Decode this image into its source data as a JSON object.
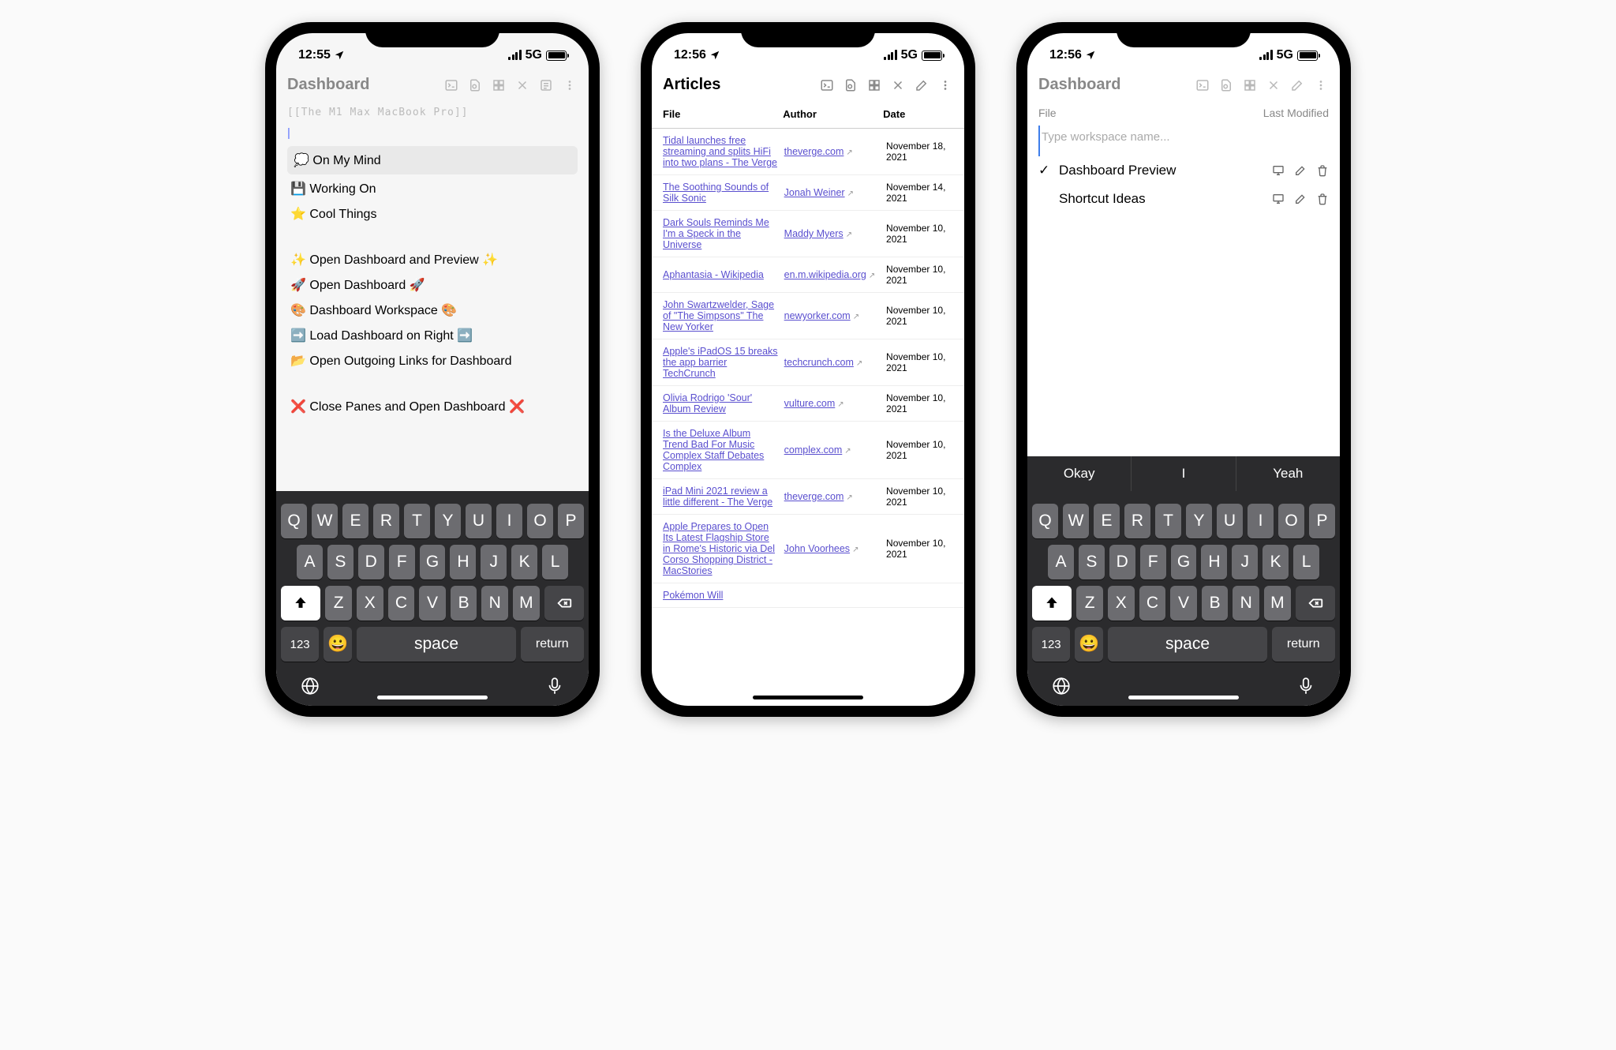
{
  "status": {
    "time1": "12:55",
    "time2": "12:56",
    "network": "5G"
  },
  "phone1": {
    "title": "Dashboard",
    "ghost_title": "[[The M1 Max MacBook Pro]]",
    "items_top": [
      "💭 On My Mind",
      "💾 Working On",
      "⭐ Cool Things"
    ],
    "items_mid": [
      "✨ Open Dashboard and Preview ✨",
      "🚀 Open Dashboard 🚀",
      "🎨 Dashboard Workspace 🎨",
      "➡️ Load Dashboard on Right ➡️",
      "📂 Open Outgoing Links for Dashboard"
    ],
    "items_bot": [
      "❌ Close Panes and Open Dashboard ❌"
    ]
  },
  "phone2": {
    "title": "Articles",
    "headers": {
      "file": "File",
      "author": "Author",
      "date": "Date"
    },
    "rows": [
      {
        "file": "Tidal launches free streaming and splits HiFi into two plans - The Verge",
        "author": "theverge.com",
        "date": "November 18, 2021"
      },
      {
        "file": "The Soothing Sounds of Silk Sonic",
        "author": "Jonah Weiner",
        "date": "November 14, 2021"
      },
      {
        "file": "Dark Souls Reminds Me I'm a Speck in the Universe",
        "author": "Maddy Myers",
        "date": "November 10, 2021"
      },
      {
        "file": "Aphantasia - Wikipedia",
        "author": "en.m.wikipedia.org",
        "date": "November 10, 2021"
      },
      {
        "file": "John Swartzwelder, Sage of \"The Simpsons\" The New Yorker",
        "author": "newyorker.com",
        "date": "November 10, 2021"
      },
      {
        "file": "Apple's iPadOS 15 breaks the app barrier TechCrunch",
        "author": "techcrunch.com",
        "date": "November 10, 2021"
      },
      {
        "file": "Olivia Rodrigo 'Sour' Album Review",
        "author": "vulture.com",
        "date": "November 10, 2021"
      },
      {
        "file": "Is the Deluxe Album Trend Bad For Music Complex Staff Debates Complex",
        "author": "complex.com",
        "date": "November 10, 2021"
      },
      {
        "file": "iPad Mini 2021 review a little different - The Verge",
        "author": "theverge.com",
        "date": "November 10, 2021"
      },
      {
        "file": "Apple Prepares to Open Its Latest Flagship Store in Rome's Historic via Del Corso Shopping District - MacStories",
        "author": "John Voorhees",
        "date": "November 10, 2021"
      },
      {
        "file": "Pokémon Will",
        "author": "",
        "date": ""
      }
    ]
  },
  "phone3": {
    "title": "Dashboard",
    "cols": {
      "file": "File",
      "modified": "Last Modified"
    },
    "placeholder": "Type workspace name...",
    "workspaces": [
      {
        "name": "Dashboard Preview",
        "checked": true
      },
      {
        "name": "Shortcut Ideas",
        "checked": false
      }
    ],
    "suggestions": [
      "Okay",
      "I",
      "Yeah"
    ]
  },
  "keyboard": {
    "row1": [
      "Q",
      "W",
      "E",
      "R",
      "T",
      "Y",
      "U",
      "I",
      "O",
      "P"
    ],
    "row2": [
      "A",
      "S",
      "D",
      "F",
      "G",
      "H",
      "J",
      "K",
      "L"
    ],
    "row3": [
      "Z",
      "X",
      "C",
      "V",
      "B",
      "N",
      "M"
    ],
    "num": "123",
    "space": "space",
    "return": "return"
  }
}
